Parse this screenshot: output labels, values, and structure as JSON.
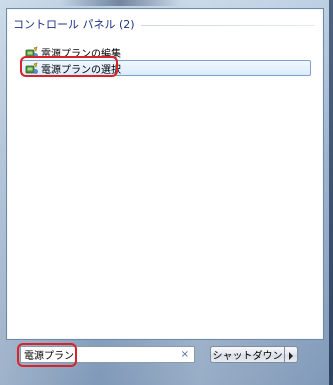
{
  "results_panel": {
    "group_title": "コントロール パネル (2)",
    "items": [
      {
        "label": "電源プランの編集",
        "icon": "power-plan-icon"
      },
      {
        "label": "電源プランの選択",
        "icon": "power-plan-icon",
        "selected": true
      }
    ]
  },
  "search": {
    "value": "電源プラン",
    "clear_label": "×"
  },
  "shutdown": {
    "label": "シャットダウン",
    "arrow_icon": "chevron-right-icon"
  },
  "colors": {
    "group_title": "#1e3287",
    "highlight_border": "#7da2ce",
    "annotation_red": "#d7232a"
  }
}
